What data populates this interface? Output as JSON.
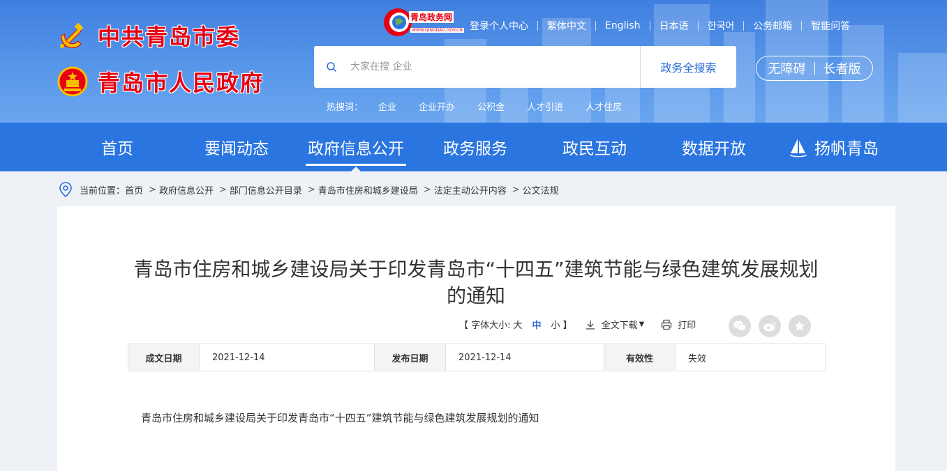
{
  "header": {
    "org1": "中共青岛市委",
    "org2": "青岛市人民政府",
    "portal_name": "青岛政务网",
    "portal_url": "WWW.QINGDAO.GOV.CN",
    "top_links": [
      "登录个人中心",
      "繁体中文",
      "English",
      "日本语",
      "한국어",
      "公务邮箱",
      "智能问答"
    ],
    "search": {
      "placeholder": "大家在搜 企业",
      "button": "政务全搜索"
    },
    "accessibility": {
      "barrier_free": "无障碍",
      "elder": "长者版"
    },
    "hot_label": "热搜词：",
    "hot_words": [
      "企业",
      "企业开办",
      "公积金",
      "人才引进",
      "人才住房"
    ]
  },
  "nav": {
    "items": [
      "首页",
      "要闻动态",
      "政府信息公开",
      "政务服务",
      "政民互动",
      "数据开放",
      "扬帆青岛"
    ],
    "active_index": 2
  },
  "breadcrumb": {
    "label": "当前位置：",
    "items": [
      "首页",
      "政府信息公开",
      "部门信息公开目录",
      "青岛市住房和城乡建设局",
      "法定主动公开内容",
      "公文法规"
    ]
  },
  "article": {
    "title": "青岛市住房和城乡建设局关于印发青岛市“十四五”建筑节能与绿色建筑发展规划的通知",
    "tools": {
      "font_open": "【 字体大小:",
      "font_large": "大",
      "font_medium": "中",
      "font_small": "小",
      "font_close": "】",
      "download": "全文下载",
      "print": "打印"
    },
    "meta": {
      "date_written_label": "成文日期",
      "date_written": "2021-12-14",
      "date_published_label": "发布日期",
      "date_published": "2021-12-14",
      "validity_label": "有效性",
      "validity": "失效"
    },
    "body_first_line": "青岛市住房和城乡建设局关于印发青岛市“十四五”建筑节能与绿色建筑发展规划的通知"
  },
  "colors": {
    "header_blue": "#3f7fe0",
    "nav_blue": "#2a75e0",
    "logo_red": "#e60012",
    "link_blue": "#2a6ad8"
  }
}
